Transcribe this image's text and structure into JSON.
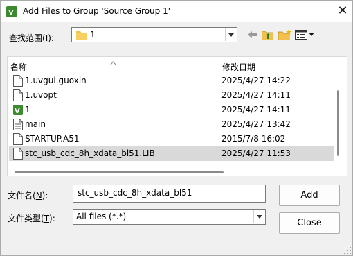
{
  "window": {
    "title": "Add Files to Group 'Source Group 1'",
    "close_glyph": "✕"
  },
  "lookin": {
    "label_main": "查找范围(",
    "label_key": "I",
    "label_end": "):",
    "value": "1"
  },
  "list": {
    "headers": {
      "name": "名称",
      "date": "修改日期"
    },
    "rows": [
      {
        "name": "1.uvgui.guoxin",
        "date": "2025/4/27 14:22",
        "icon": "document-icon"
      },
      {
        "name": "1.uvopt",
        "date": "2025/4/27 14:11",
        "icon": "document-icon"
      },
      {
        "name": "1",
        "date": "2025/4/27 14:11",
        "icon": "keil-project-icon"
      },
      {
        "name": "main",
        "date": "2025/4/27 13:42",
        "icon": "text-file-icon"
      },
      {
        "name": "STARTUP.A51",
        "date": "2015/7/8 16:02",
        "icon": "document-icon"
      },
      {
        "name": "stc_usb_cdc_8h_xdata_bl51.LIB",
        "date": "2025/4/27 11:53",
        "icon": "document-icon"
      }
    ]
  },
  "filename": {
    "label_main": "文件名(",
    "label_key": "N",
    "label_end": "):",
    "value": "stc_usb_cdc_8h_xdata_bl51"
  },
  "filetype": {
    "label_main": "文件类型(",
    "label_key": "T",
    "label_end": "):",
    "value": "All files (*.*)"
  },
  "buttons": {
    "add": "Add",
    "close": "Close"
  },
  "colors": {
    "selected_row": "#d9d9d9",
    "folder": "#f4c04d",
    "keil_green": "#3c8a2e"
  }
}
